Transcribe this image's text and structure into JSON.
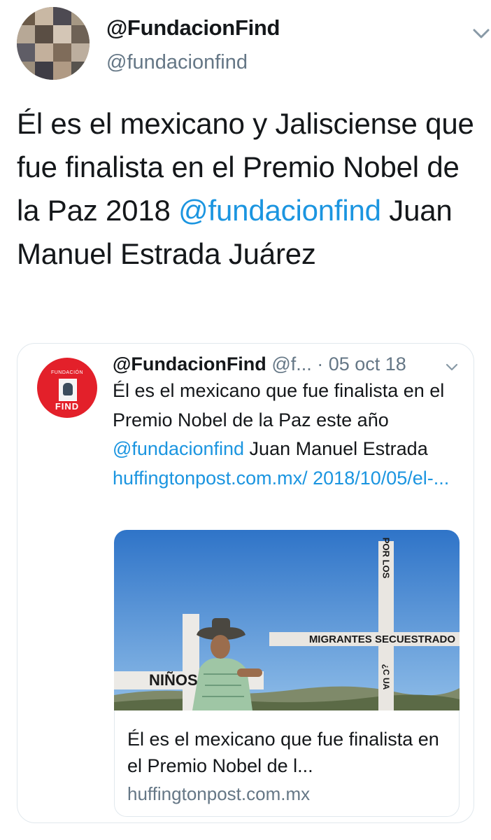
{
  "tweet": {
    "author": {
      "display_name": "@FundacionFind",
      "handle": "@fundacionfind",
      "avatar_icon": "group-photo-avatar"
    },
    "text_before_mention": "Él es el mexicano y Jalisciense que fue finalista en el Premio Nobel de la Paz 2018  ",
    "mention": "@fundacionfind",
    "text_after_mention": " Juan Manuel Estrada Juárez",
    "menu_icon": "chevron-down-icon"
  },
  "quoted_tweet": {
    "avatar": {
      "top_label": "FUNDACIÓN",
      "brand": "FIND"
    },
    "display_name": "@FundacionFind",
    "handle": "@f...",
    "separator": " · ",
    "date": "05 oct 18",
    "text_before_mention": "Él es el mexicano que fue finalista en el Premio Nobel de la Paz este año ",
    "mention": "@fundacionfind",
    "text_middle": " Juan Manuel Estrada  ",
    "link_text": "huffingtonpost.com.mx/ 2018/10/05/el-...",
    "menu_icon": "chevron-down-icon",
    "media": {
      "sign_cross_left": "NIÑOS",
      "sign_cross_right_h": "MIGRANTES SECUESTRADO",
      "sign_cross_right_v": "POR LOS",
      "sign_cross_right_v2": "¿C UA"
    },
    "link_card": {
      "title": "Él es el mexicano que fue finalista en el Premio Nobel de l...",
      "domain": "huffingtonpost.com.mx"
    }
  },
  "colors": {
    "link": "#1b95e0",
    "text": "#14171a",
    "secondary": "#657786",
    "border": "#e1e8ed",
    "brand_red": "#e3202a"
  }
}
